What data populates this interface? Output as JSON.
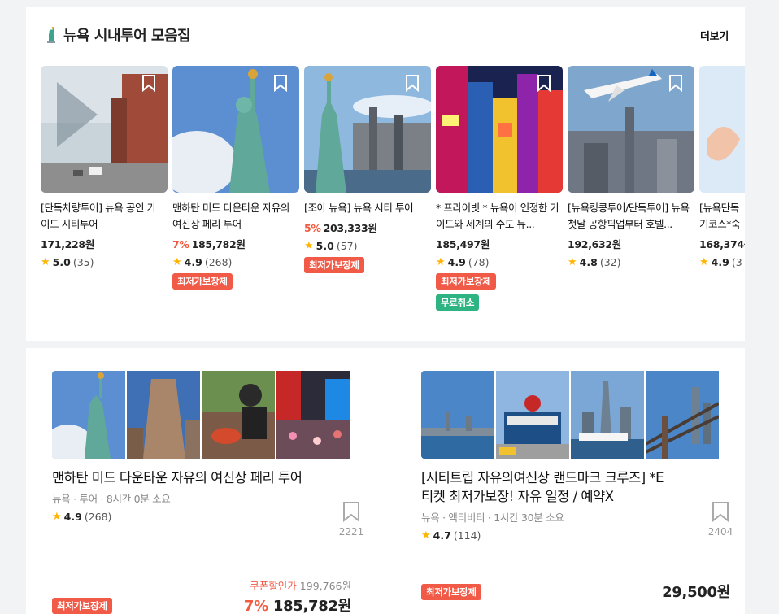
{
  "section": {
    "title": "뉴욕 시내투어 모음집",
    "icon": "statue-of-liberty-icon",
    "more_label": "더보기"
  },
  "cards": [
    {
      "title": "[단독차량투어]  뉴욕 공인 가이드 시티투어",
      "discount": "",
      "price": "171,228원",
      "rating": "5.0",
      "reviews": "(35)",
      "badges": []
    },
    {
      "title": "맨하탄 미드 다운타운 자유의 여신상 페리 투어",
      "discount": "7%",
      "price": "185,782원",
      "rating": "4.9",
      "reviews": "(268)",
      "badges": [
        "최저가보장제"
      ]
    },
    {
      "title": "[조아 뉴욕] 뉴욕 시티 투어",
      "discount": "5%",
      "price": "203,333원",
      "rating": "5.0",
      "reviews": "(57)",
      "badges": [
        "최저가보장제"
      ]
    },
    {
      "title": "* 프라이빗 * 뉴욕이 인정한 가이드와 세계의 수도 뉴...",
      "discount": "",
      "price": "185,497원",
      "rating": "4.9",
      "reviews": "(78)",
      "badges": [
        "최저가보장제",
        "무료취소"
      ]
    },
    {
      "title": "[뉴욕킹콩투어/단독투어] 뉴욕첫날 공항픽업부터 호텔...",
      "discount": "",
      "price": "192,632원",
      "rating": "4.8",
      "reviews": "(32)",
      "badges": []
    },
    {
      "title": "[뉴욕단독 기코스*숙",
      "discount": "",
      "price": "168,374원",
      "rating": "4.9",
      "reviews": "(3",
      "badges": []
    }
  ],
  "big_cards": [
    {
      "title": "맨하탄 미드 다운타운 자유의 여신상 페리 투어",
      "meta": "뉴욕 · 투어 · 8시간 0분 소요",
      "rating": "4.9",
      "reviews": "(268)",
      "bookmarks": "2221",
      "badge": "최저가보장제",
      "coupon_label": "쿠폰할인가",
      "original_price": "199,766원",
      "discount": "7%",
      "price": "185,782원"
    },
    {
      "title": "[시티트립 자유의여신상 랜드마크 크루즈] *E티켓 최저가보장! 자유 일정 / 예약X",
      "meta": "뉴욕 · 액티비티 · 1시간 30분 소요",
      "rating": "4.7",
      "reviews": "(114)",
      "bookmarks": "2404",
      "badge": "최저가보장제",
      "price": "29,500원"
    }
  ],
  "colors": {
    "accent_red": "#f05a47",
    "accent_green": "#2eb482",
    "star": "#ffb400"
  }
}
